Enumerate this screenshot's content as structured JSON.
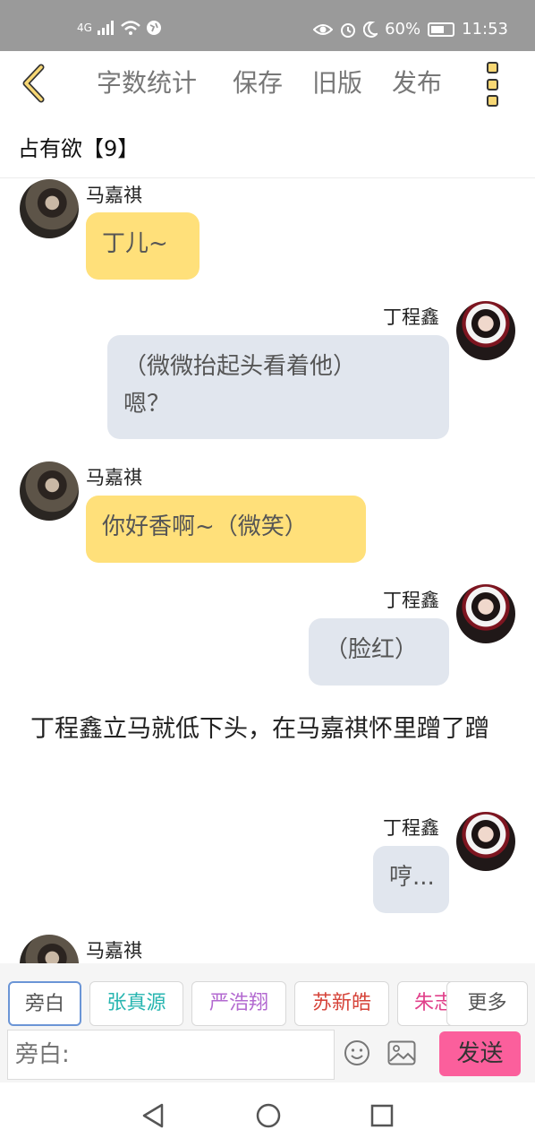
{
  "status_bar": {
    "network": "4G",
    "battery": "60%",
    "time": "11:53",
    "icons": [
      "signal-icon",
      "wifi-icon",
      "globe-icon",
      "eye-icon",
      "alarm-icon",
      "moon-icon",
      "battery-icon"
    ]
  },
  "header": {
    "word_count": "字数统计",
    "save": "保存",
    "old_version": "旧版",
    "publish": "发布",
    "accent_color": "#f7d774"
  },
  "story": {
    "title": "占有欲【9】"
  },
  "messages": [
    {
      "sender": "马嘉祺",
      "side": "left",
      "text": "丁儿~"
    },
    {
      "sender": "丁程鑫",
      "side": "right",
      "lines": [
        "（微微抬起头看着他）",
        "嗯？"
      ]
    },
    {
      "sender": "马嘉祺",
      "side": "left",
      "text": "你好香啊~（微笑）"
    },
    {
      "sender": "丁程鑫",
      "side": "right",
      "text": "（脸红）"
    },
    {
      "narration": "丁程鑫立马就低下头，在马嘉祺怀里蹭了蹭"
    },
    {
      "sender": "丁程鑫",
      "side": "right",
      "text": "哼..."
    },
    {
      "sender": "马嘉祺",
      "side": "left"
    }
  ],
  "characters": [
    {
      "name": "旁白",
      "color": "#555555"
    },
    {
      "name": "张真源",
      "color": "#27b5b0"
    },
    {
      "name": "严浩翔",
      "color": "#b36ad0"
    },
    {
      "name": "苏新皓",
      "color": "#d6443a"
    },
    {
      "name": "朱志鑫",
      "color": "#e0408a"
    }
  ],
  "more_label": "更多",
  "input": {
    "placeholder": "旁白:",
    "send_label": "发送",
    "send_color": "#fb5f9c"
  }
}
